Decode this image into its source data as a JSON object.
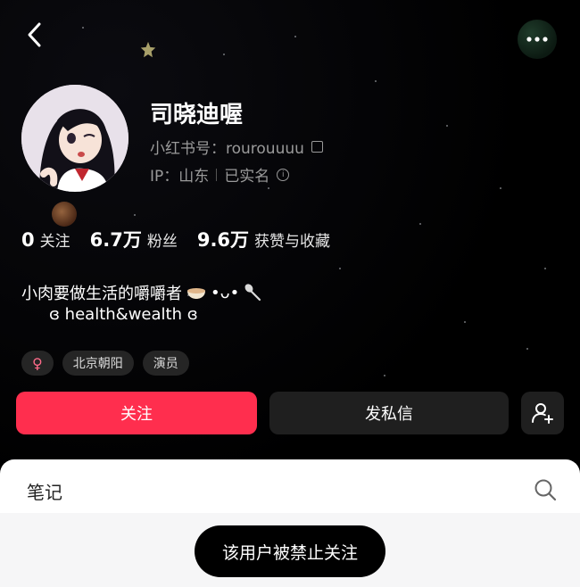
{
  "profile": {
    "name": "司晓迪喔",
    "id_label": "小红书号：rourouuuu",
    "ip_label": "IP：山东",
    "verified_label": "已实名"
  },
  "stats": [
    {
      "value": "0",
      "label": "关注"
    },
    {
      "value": "6.7万",
      "label": "粉丝"
    },
    {
      "value": "9.6万",
      "label": "获赞与收藏"
    }
  ],
  "bio": {
    "line1": "小肉要做生活的嚼嚼者",
    "line1_suffix": "•ᴗ•",
    "line2": "ɞ health&wealth ɞ"
  },
  "tags": {
    "gender": "♀",
    "location": "北京朝阳",
    "occupation": "演员"
  },
  "actions": {
    "follow": "关注",
    "message": "发私信"
  },
  "tabs": {
    "notes": "笔记"
  },
  "toast": "该用户被禁止关注",
  "colors": {
    "follow_button": "#ff2e4e",
    "background": "#000000",
    "sheet": "#ffffff"
  }
}
